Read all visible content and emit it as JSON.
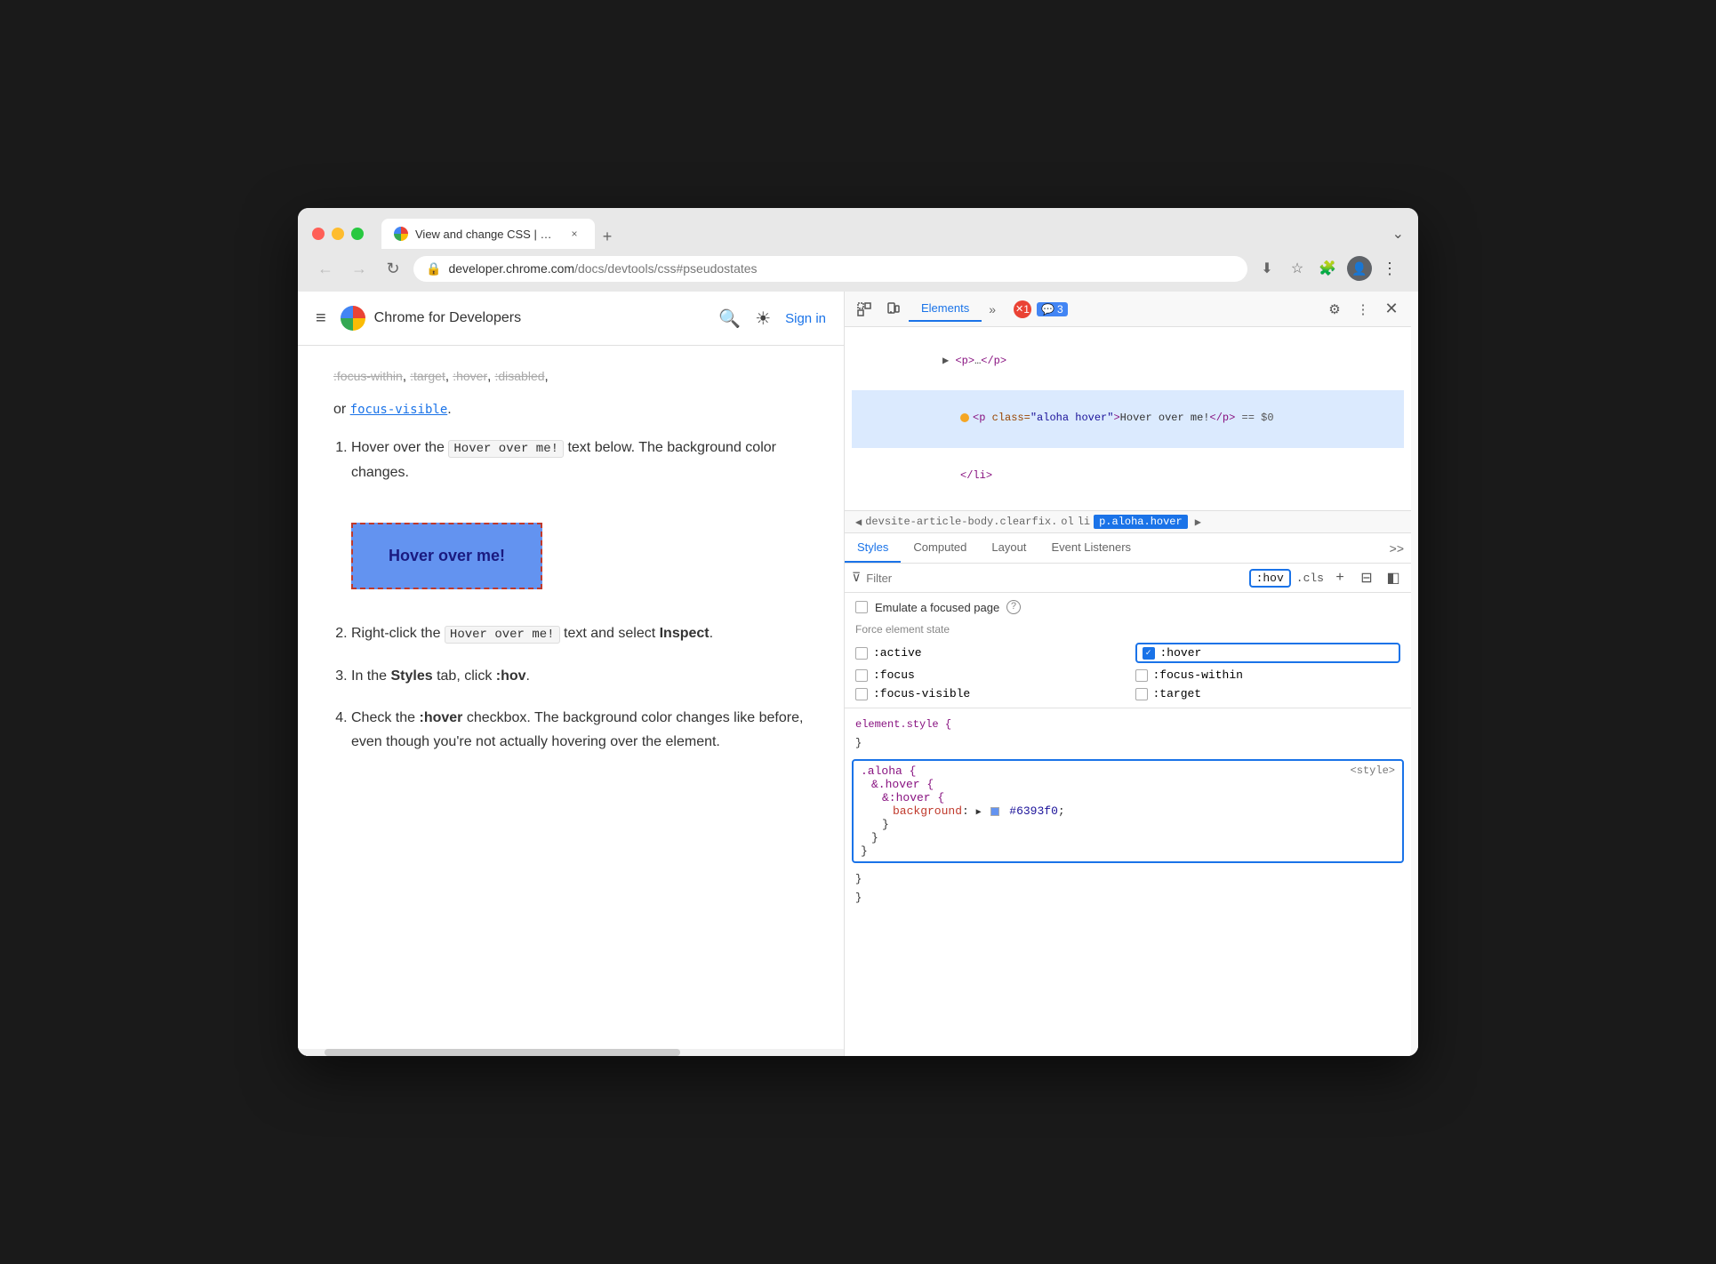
{
  "browser": {
    "window_controls": {
      "close_label": "×",
      "min_label": "−",
      "max_label": "+"
    },
    "tab": {
      "title": "View and change CSS | Chr…",
      "close_label": "×"
    },
    "new_tab_label": "+",
    "chevron_label": "⌄",
    "address": {
      "icon": "🔒",
      "domain": "developer.chrome.com",
      "path": "/docs/devtools/css#pseudostates"
    },
    "toolbar": {
      "download_icon": "⬇",
      "star_icon": "☆",
      "extensions_icon": "🧩",
      "profile_icon": "👤",
      "menu_icon": "⋮"
    }
  },
  "site_header": {
    "hamburger": "≡",
    "site_name": "Chrome for Developers",
    "search_label": "🔍",
    "theme_label": "☀",
    "sign_in_label": "Sign in"
  },
  "webpage": {
    "top_links_text": ", , , ,",
    "top_links": [
      ":focus-within",
      ":target",
      ":hover",
      ":disabled"
    ],
    "or_text": "or",
    "focus_visible_link": "focus-visible",
    "focus_visible_dot": ".",
    "list_items": [
      {
        "id": 1,
        "text_before": "Hover over the",
        "code": "Hover over me!",
        "text_after": "text below. The background color changes."
      },
      {
        "id": 2,
        "text_before": "Right-click the",
        "code": "Hover over me!",
        "text_after": "text and select",
        "bold": "Inspect",
        "text_end": "."
      },
      {
        "id": 3,
        "text_before": "In the",
        "bold_before": "Styles",
        "text_mid": "tab, click",
        "code": ":hov",
        "text_after": "."
      },
      {
        "id": 4,
        "text_before": "Check the",
        "bold": ":hover",
        "text_after": "checkbox. The background color changes like before, even though you're not actually hovering over the element."
      }
    ],
    "hover_box_label": "Hover over me!"
  },
  "devtools": {
    "tools": {
      "select_icon": "⬚",
      "device_icon": "📱",
      "more_icon": "»"
    },
    "tabs": [
      {
        "label": "Elements",
        "active": true
      },
      {
        "label": "»"
      }
    ],
    "error_count": "1",
    "warning_count": "3",
    "settings_icon": "⚙",
    "menu_icon": "⋮",
    "close_icon": "×",
    "dom": {
      "lines": [
        {
          "indent": 1,
          "content": "▶ <p>…</p>",
          "selected": false
        },
        {
          "indent": 2,
          "content": "<p class=\"aloha hover\">Hover over me!</p> == $0",
          "selected": true,
          "has_dot": true
        },
        {
          "indent": 2,
          "content": "</li>",
          "selected": false
        }
      ]
    },
    "breadcrumb": {
      "left_arrow": "◀",
      "right_arrow": "▶",
      "items": [
        {
          "label": "devsite-article-body.clearfix.",
          "selected": false
        },
        {
          "label": "ol",
          "selected": false
        },
        {
          "label": "li",
          "selected": false
        },
        {
          "label": "p.aloha.hover",
          "selected": true
        }
      ]
    },
    "style_tabs": [
      {
        "label": "Styles",
        "active": true
      },
      {
        "label": "Computed"
      },
      {
        "label": "Layout"
      },
      {
        "label": "Event Listeners"
      },
      {
        "label": ">>"
      }
    ],
    "filter": {
      "placeholder": "Filter",
      "hov_label": ":hov",
      "cls_label": ".cls",
      "plus_icon": "+",
      "toggle_icon": "⊟",
      "layout_icon": "◧"
    },
    "emulate": {
      "label": "Emulate a focused page",
      "info_icon": "?"
    },
    "force_state": {
      "label": "Force element state",
      "states": [
        {
          "id": "active",
          "label": ":active",
          "checked": false
        },
        {
          "id": "hover",
          "label": ":hover",
          "checked": true,
          "highlighted": true
        },
        {
          "id": "focus",
          "label": ":focus",
          "checked": false
        },
        {
          "id": "focus-within",
          "label": ":focus-within",
          "checked": false
        },
        {
          "id": "focus-visible",
          "label": ":focus-visible",
          "checked": false
        },
        {
          "id": "target",
          "label": ":target",
          "checked": false
        }
      ]
    },
    "css_rules": [
      {
        "selector": "element.style {",
        "properties": [],
        "close": "}",
        "source": ""
      },
      {
        "highlighted": true,
        "selector": ".aloha {",
        "nested": [
          {
            "selector": "&.hover {",
            "nested": [
              {
                "selector": "&:hover {",
                "properties": [
                  {
                    "name": "background",
                    "value": "#6393f0",
                    "has_swatch": true
                  }
                ],
                "close": "}"
              }
            ],
            "close": "}"
          }
        ],
        "close": "}",
        "source": "<style>"
      }
    ]
  }
}
